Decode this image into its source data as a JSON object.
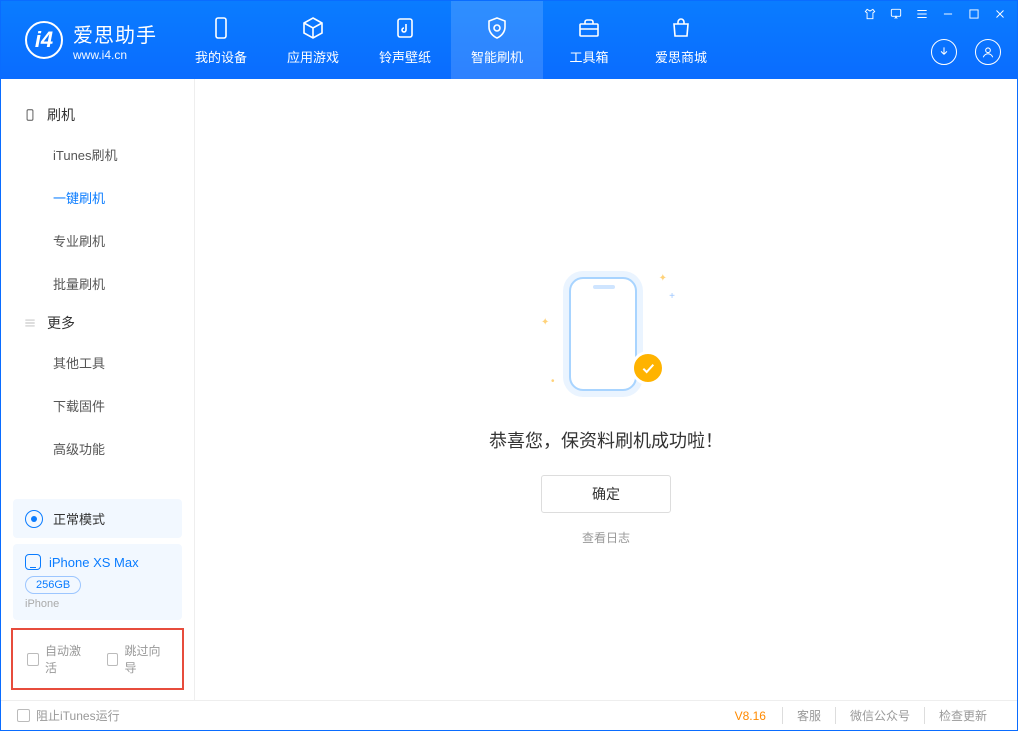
{
  "app": {
    "title": "爱思助手",
    "subtitle": "www.i4.cn"
  },
  "tabs": [
    {
      "label": "我的设备"
    },
    {
      "label": "应用游戏"
    },
    {
      "label": "铃声壁纸"
    },
    {
      "label": "智能刷机"
    },
    {
      "label": "工具箱"
    },
    {
      "label": "爱思商城"
    }
  ],
  "sidebar": {
    "section1": {
      "title": "刷机",
      "items": [
        "iTunes刷机",
        "一键刷机",
        "专业刷机",
        "批量刷机"
      ]
    },
    "section2": {
      "title": "更多",
      "items": [
        "其他工具",
        "下载固件",
        "高级功能"
      ]
    },
    "mode_label": "正常模式",
    "device": {
      "name": "iPhone XS Max",
      "capacity": "256GB",
      "type": "iPhone"
    },
    "checkbox1": "自动激活",
    "checkbox2": "跳过向导"
  },
  "main": {
    "success_text": "恭喜您，保资料刷机成功啦！",
    "ok_button": "确定",
    "view_log": "查看日志"
  },
  "footer": {
    "block_itunes": "阻止iTunes运行",
    "version": "V8.16",
    "links": [
      "客服",
      "微信公众号",
      "检查更新"
    ]
  }
}
